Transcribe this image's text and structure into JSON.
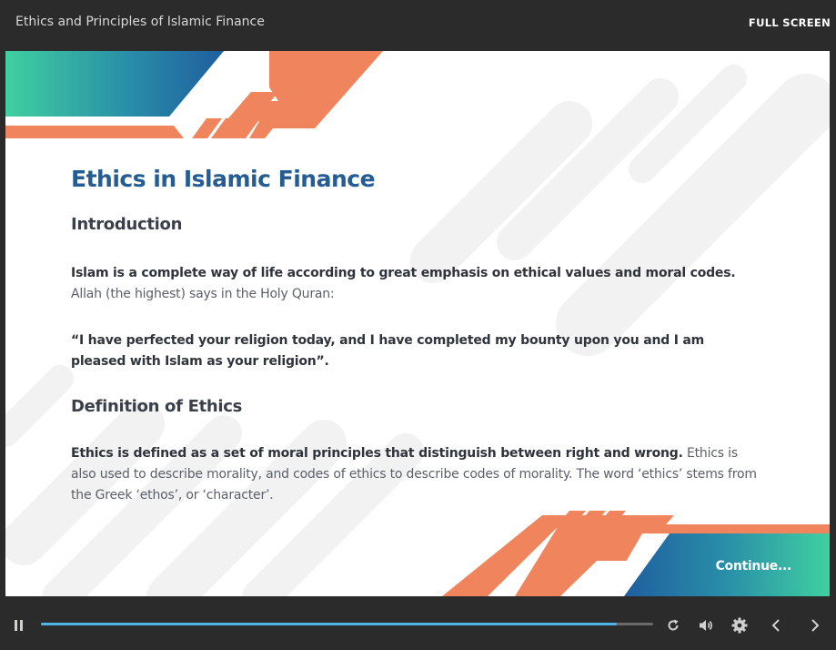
{
  "header": {
    "course_title": "Ethics and Principles of Islamic Finance",
    "fullscreen_label": "FULL SCREEN"
  },
  "slide": {
    "title": "Ethics in Islamic Finance",
    "introduction_heading": "Introduction",
    "intro_bold": "Islam is a complete way of life according to great emphasis on ethical values and moral codes.",
    "intro_text": " Allah (the highest) says in the Holy Quran:",
    "quote": "“I have perfected your religion today, and I have completed my bounty upon you and I am pleased with Islam as your religion”.",
    "definition_heading": "Definition of Ethics",
    "definition_bold": "Ethics is defined as a set of moral principles that distinguish between right and wrong.",
    "definition_text": " Ethics is also used to describe morality, and codes of ethics to describe codes of morality. The word ‘ethics’ stems from the Greek ‘ethos’, or ‘character’.",
    "continue_label": "Continue..."
  },
  "player": {
    "progress_fraction": 0.94,
    "icons": [
      "pause-icon",
      "replay-icon",
      "volume-icon",
      "settings-icon",
      "previous-icon",
      "next-icon"
    ]
  },
  "colors": {
    "accent_orange": "#f0845c",
    "accent_teal": "#3fd0a0",
    "accent_blue": "#1f5ea0",
    "title_blue": "#245c93",
    "progress_blue": "#4fb3e8"
  }
}
